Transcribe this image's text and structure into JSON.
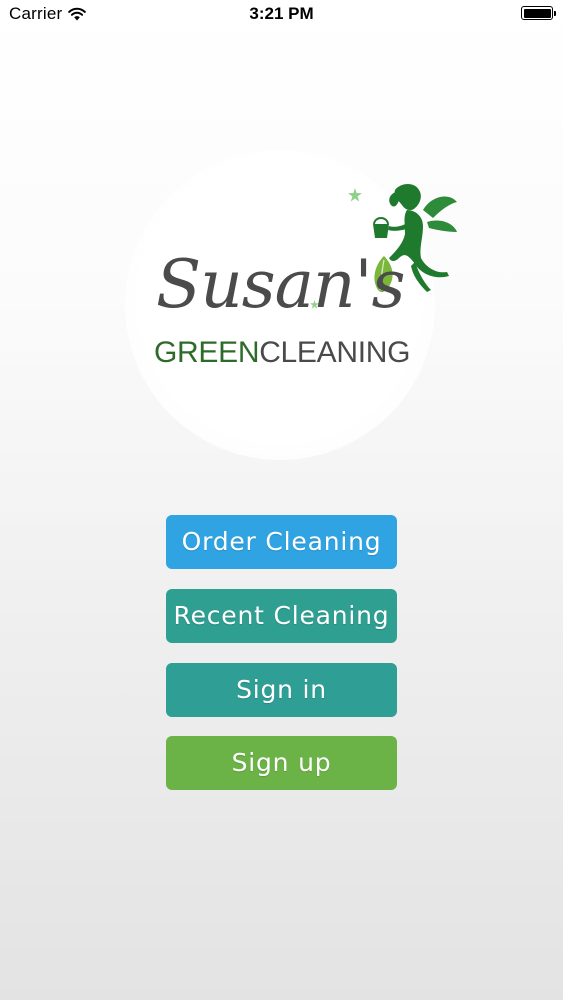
{
  "status_bar": {
    "carrier": "Carrier",
    "time": "3:21 PM",
    "battery_level": 1.0
  },
  "logo": {
    "script_text": "Susan's",
    "sub_green": "GREEN",
    "sub_gray": "CLEANING",
    "icon": "fairy-icon",
    "colors": {
      "green": "#2e6b2a",
      "gray": "#4a4a4a",
      "leaf": "#7ab63a"
    }
  },
  "menu": {
    "order_cleaning": "Order Cleaning",
    "recent_cleaning": "Recent Cleaning",
    "sign_in": "Sign in",
    "sign_up": "Sign up"
  },
  "colors": {
    "blue": "#30a4e3",
    "teal": "#2f9f92",
    "green": "#6cb347"
  }
}
